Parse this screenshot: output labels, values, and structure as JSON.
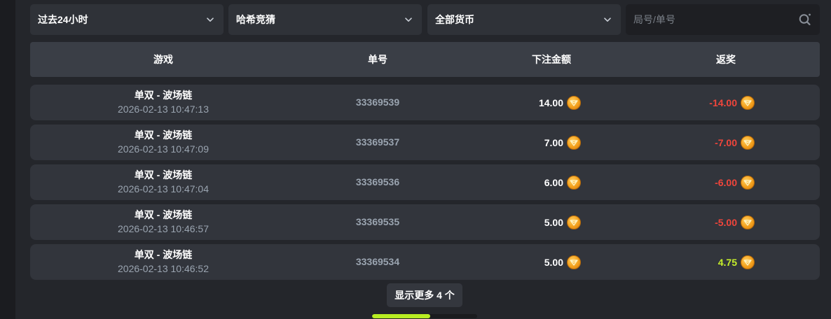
{
  "filters": {
    "time_range": "过去24小时",
    "game": "哈希竞猜",
    "currency": "全部货币",
    "search_placeholder": "局号/单号"
  },
  "table": {
    "headers": [
      "游戏",
      "单号",
      "下注金额",
      "返奖"
    ],
    "rows": [
      {
        "game": "单双 - 波场链",
        "time": "2026-02-13 10:47:13",
        "order_no": "33369539",
        "bet": "14.00",
        "payout": "-14.00",
        "payout_status": "loss"
      },
      {
        "game": "单双 - 波场链",
        "time": "2026-02-13 10:47:09",
        "order_no": "33369537",
        "bet": "7.00",
        "payout": "-7.00",
        "payout_status": "loss"
      },
      {
        "game": "单双 - 波场链",
        "time": "2026-02-13 10:47:04",
        "order_no": "33369536",
        "bet": "6.00",
        "payout": "-6.00",
        "payout_status": "loss"
      },
      {
        "game": "单双 - 波场链",
        "time": "2026-02-13 10:46:57",
        "order_no": "33369535",
        "bet": "5.00",
        "payout": "-5.00",
        "payout_status": "loss"
      },
      {
        "game": "单双 - 波场链",
        "time": "2026-02-13 10:46:52",
        "order_no": "33369534",
        "bet": "5.00",
        "payout": "4.75",
        "payout_status": "win"
      }
    ]
  },
  "load_more_label": "显示更多 4 个",
  "progress_fraction": 0.55,
  "colors": {
    "loss": "#f0453b",
    "win": "#c6ef2b",
    "accent": "#b8ee22",
    "coin": "#f3a01d"
  },
  "icons": {
    "dropdown": "chevron-down-icon",
    "search": "search-icon",
    "currency": "coin-icon"
  }
}
